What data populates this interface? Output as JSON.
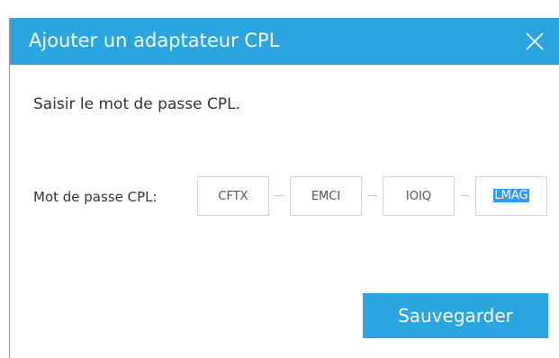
{
  "background": {
    "partial_heading_prefix": "",
    "partial_heading_link": ""
  },
  "dialog": {
    "title": "Ajouter un adaptateur CPL",
    "close_icon": "close-x-icon",
    "instruction": "Saisir le mot de passe CPL.",
    "password_label": "Mot de passe CPL:",
    "password_segments": [
      "CFTX",
      "EMCI",
      "IOIQ",
      "LMAG"
    ],
    "active_segment_index": 3,
    "active_segment_selected": true,
    "save_label": "Sauvegarder"
  },
  "colors": {
    "accent": "#2ba5e0",
    "selection": "#3399ff",
    "field_border": "#d4d4d4",
    "text": "#333333"
  }
}
